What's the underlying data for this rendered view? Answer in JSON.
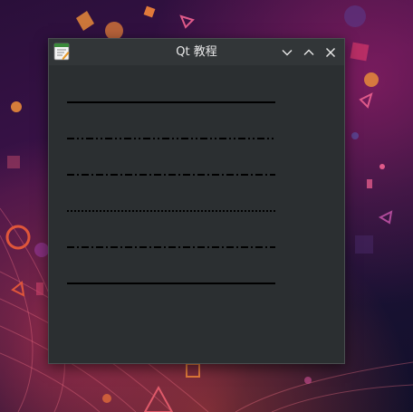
{
  "window": {
    "title": "Qt 教程"
  },
  "controls": [
    "minimize-icon",
    "maximize-icon",
    "close-icon"
  ],
  "lines": [
    {
      "style": "solid"
    },
    {
      "style": "dash-dot-dot"
    },
    {
      "style": "dash-dot"
    },
    {
      "style": "dot"
    },
    {
      "style": "dash-dot"
    },
    {
      "style": "solid"
    }
  ],
  "colors": {
    "window_bg": "#2b2f31",
    "titlebar_bg": "#323638",
    "line": "#000000"
  }
}
